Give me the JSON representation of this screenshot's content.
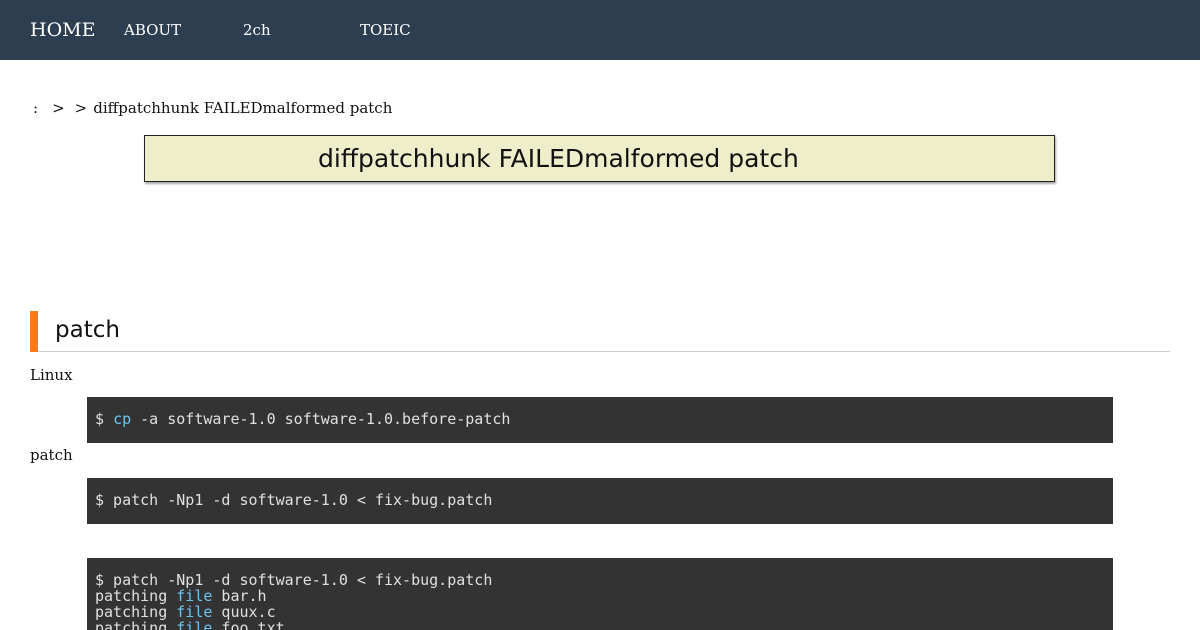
{
  "nav": {
    "home": "HOME",
    "about": "ABOUT",
    "twoch": "2ch",
    "toeic": "TOEIC"
  },
  "breadcrumb": {
    "root": ":",
    "sep1": ">",
    "sep2": ">",
    "current": "diffpatchhunk FAILEDmalformed patch"
  },
  "page_title": "diffpatchhunk FAILEDmalformed patch",
  "section": {
    "title": "patch"
  },
  "paragraphs": {
    "p1": "Linux",
    "p2": "patch"
  },
  "code_blocks": {
    "b1": {
      "prompt": "$ ",
      "cmd": "cp",
      "rest": " -a software-1.0 software-1.0.before-patch"
    },
    "b2": {
      "line": "$ patch -Np1 -d software-1.0 < fix-bug.patch"
    },
    "b3": {
      "line1": "$ patch -Np1 -d software-1.0 < fix-bug.patch",
      "line2_a": "patching ",
      "line2_kw": "file",
      "line2_b": " bar.h",
      "line3_a": "patching ",
      "line3_kw": "file",
      "line3_b": " quux.c",
      "line4_a": "patching ",
      "line4_kw": "file",
      "line4_b": " foo.txt"
    }
  },
  "colors": {
    "navbar": "#2c3e50",
    "title_bg": "#efeecb",
    "accent_bar": "#f47c20",
    "code_bg": "#333333",
    "code_keyword": "#6cc4f0"
  }
}
